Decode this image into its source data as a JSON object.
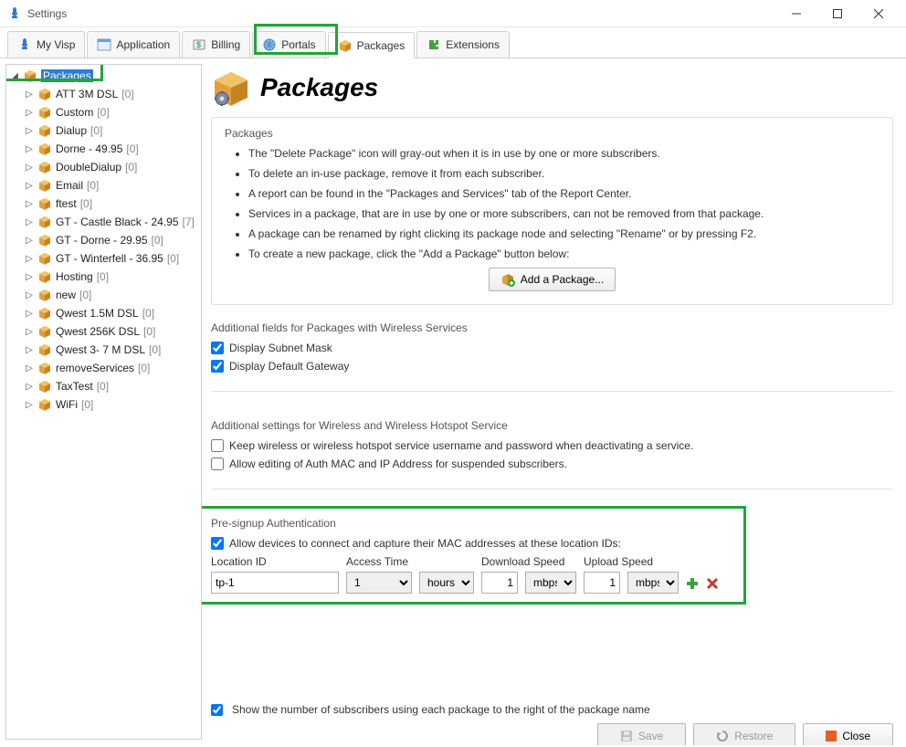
{
  "window": {
    "title": "Settings"
  },
  "tabs": {
    "myvisp": "My Visp",
    "application": "Application",
    "billing": "Billing",
    "portals": "Portals",
    "packages": "Packages",
    "extensions": "Extensions"
  },
  "sidebar": {
    "root": {
      "label": "Packages"
    },
    "items": [
      {
        "label": "ATT 3M DSL",
        "count": "[0]"
      },
      {
        "label": "Custom",
        "count": "[0]"
      },
      {
        "label": "Dialup",
        "count": "[0]"
      },
      {
        "label": "Dorne - 49.95",
        "count": "[0]"
      },
      {
        "label": "DoubleDialup",
        "count": "[0]"
      },
      {
        "label": "Email",
        "count": "[0]"
      },
      {
        "label": "ftest",
        "count": "[0]"
      },
      {
        "label": "GT - Castle Black - 24.95",
        "count": "[7]"
      },
      {
        "label": "GT - Dorne - 29.95",
        "count": "[0]"
      },
      {
        "label": "GT - Winterfell - 36.95",
        "count": "[0]"
      },
      {
        "label": "Hosting",
        "count": "[0]"
      },
      {
        "label": "new",
        "count": "[0]"
      },
      {
        "label": "Qwest 1.5M DSL",
        "count": "[0]"
      },
      {
        "label": "Qwest 256K DSL",
        "count": "[0]"
      },
      {
        "label": "Qwest 3- 7 M DSL",
        "count": "[0]"
      },
      {
        "label": "removeServices",
        "count": "[0]"
      },
      {
        "label": "TaxTest",
        "count": "[0]"
      },
      {
        "label": "WiFi",
        "count": "[0]"
      }
    ]
  },
  "page": {
    "title": "Packages"
  },
  "packagesSection": {
    "title": "Packages",
    "bullets": {
      "b0": "The \"Delete Package\" icon will gray-out when it is in use by one or more subscribers.",
      "b1": "To delete an in-use package, remove it from each subscriber.",
      "b2": "A report can be found in the \"Packages and Services\" tab of the Report Center.",
      "b3": "Services in a package, that are in use by one or more subscribers, can not be removed from that package.",
      "b4": "A package can be renamed by right clicking its package node and selecting \"Rename\" or by pressing F2.",
      "b5": "To create a new package, click the \"Add a Package\" button below:"
    },
    "addButton": "Add a Package..."
  },
  "wirelessFields": {
    "title": "Additional fields for Packages with Wireless Services",
    "subnet": "Display Subnet Mask",
    "gateway": "Display Default Gateway"
  },
  "wirelessSettings": {
    "title": "Additional settings for Wireless and Wireless Hotspot Service",
    "keep": "Keep wireless or wireless hotspot service username and password when deactivating a service.",
    "allowEdit": "Allow editing of Auth MAC and IP Address for suspended subscribers."
  },
  "presignup": {
    "title": "Pre-signup Authentication",
    "allow": "Allow devices to connect and capture their MAC addresses at these location IDs:",
    "labels": {
      "locationId": "Location ID",
      "accessTime": "Access Time",
      "downloadSpeed": "Download Speed",
      "uploadSpeed": "Upload Speed"
    },
    "row": {
      "locationId": "tp-1",
      "accessValue": "1",
      "accessUnit": "hours",
      "downloadValue": "1",
      "downloadUnit": "mbps",
      "uploadValue": "1",
      "uploadUnit": "mbps"
    }
  },
  "footer": {
    "showCount": "Show the number of subscribers using each package to the right of the package name",
    "save": "Save",
    "restore": "Restore",
    "close": "Close"
  }
}
